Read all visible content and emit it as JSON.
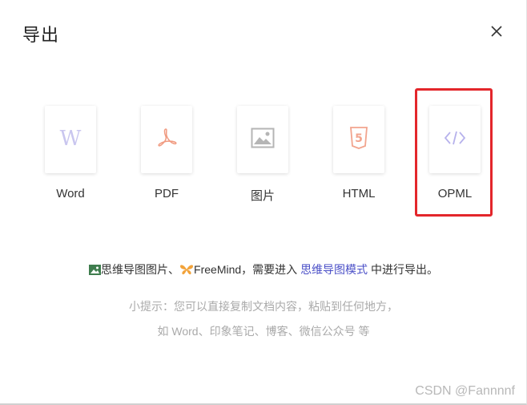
{
  "dialog": {
    "title": "导出"
  },
  "options": [
    {
      "label": "Word",
      "icon": "word-icon"
    },
    {
      "label": "PDF",
      "icon": "pdf-icon"
    },
    {
      "label": "图片",
      "icon": "image-icon"
    },
    {
      "label": "HTML",
      "icon": "html5-icon"
    },
    {
      "label": "OPML",
      "icon": "code-icon"
    }
  ],
  "hint": {
    "part1": "思维导图图片、",
    "part2": "FreeMind，需要进入 ",
    "link": "思维导图模式",
    "part3": " 中进行导出。"
  },
  "tips": {
    "line1": "小提示：您可以直接复制文档内容，粘贴到任何地方，",
    "line2": "如 Word、印象笔记、博客、微信公众号 等"
  },
  "watermark": "CSDN @Fannnnf",
  "colors": {
    "highlight": "#e3262b",
    "link": "#4a4fc7",
    "word_icon": "#c9c6ef",
    "pdf_icon": "#f09a80",
    "image_icon": "#b5b5b5",
    "html_icon": "#f2a48e",
    "code_icon": "#b7b2ec"
  }
}
